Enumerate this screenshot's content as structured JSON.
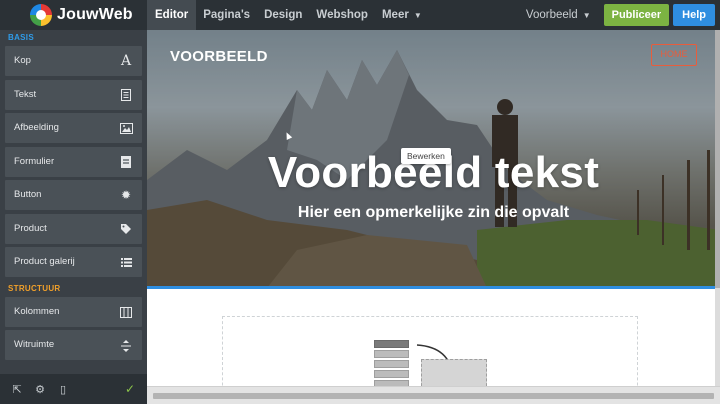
{
  "topbar": {
    "logo_text": "JouwWeb",
    "nav": [
      {
        "label": "Editor"
      },
      {
        "label": "Pagina's"
      },
      {
        "label": "Design"
      },
      {
        "label": "Webshop"
      },
      {
        "label": "Meer"
      }
    ],
    "page_select": "Voorbeeld",
    "publish_label": "Publiceer",
    "help_label": "Help"
  },
  "sidebar": {
    "basis_title": "BASIS",
    "basis_items": [
      {
        "label": "Kop",
        "icon": "heading-icon"
      },
      {
        "label": "Tekst",
        "icon": "text-icon"
      },
      {
        "label": "Afbeelding",
        "icon": "image-icon"
      },
      {
        "label": "Formulier",
        "icon": "form-icon"
      },
      {
        "label": "Button",
        "icon": "button-icon"
      },
      {
        "label": "Product",
        "icon": "tag-icon"
      },
      {
        "label": "Product galerij",
        "icon": "list-icon"
      }
    ],
    "structuur_title": "STRUCTUUR",
    "structuur_items": [
      {
        "label": "Kolommen",
        "icon": "columns-icon"
      },
      {
        "label": "Witruimte",
        "icon": "spacing-icon"
      }
    ]
  },
  "canvas": {
    "brand": "VOORBEELD",
    "home_label": "HOME",
    "tooltip": "Bewerken",
    "hero_title": "Voorbeeld tekst",
    "hero_subtitle": "Hier een opmerkelijke zin die opvalt"
  },
  "colors": {
    "topbar_bg": "#2b3136",
    "sidebar_bg": "#3a4046",
    "publish_green": "#7cb342",
    "help_blue": "#2f8ee0",
    "basis_blue": "#2f9be8",
    "structuur_orange": "#f1a02a",
    "home_orange": "#e85d3c"
  }
}
